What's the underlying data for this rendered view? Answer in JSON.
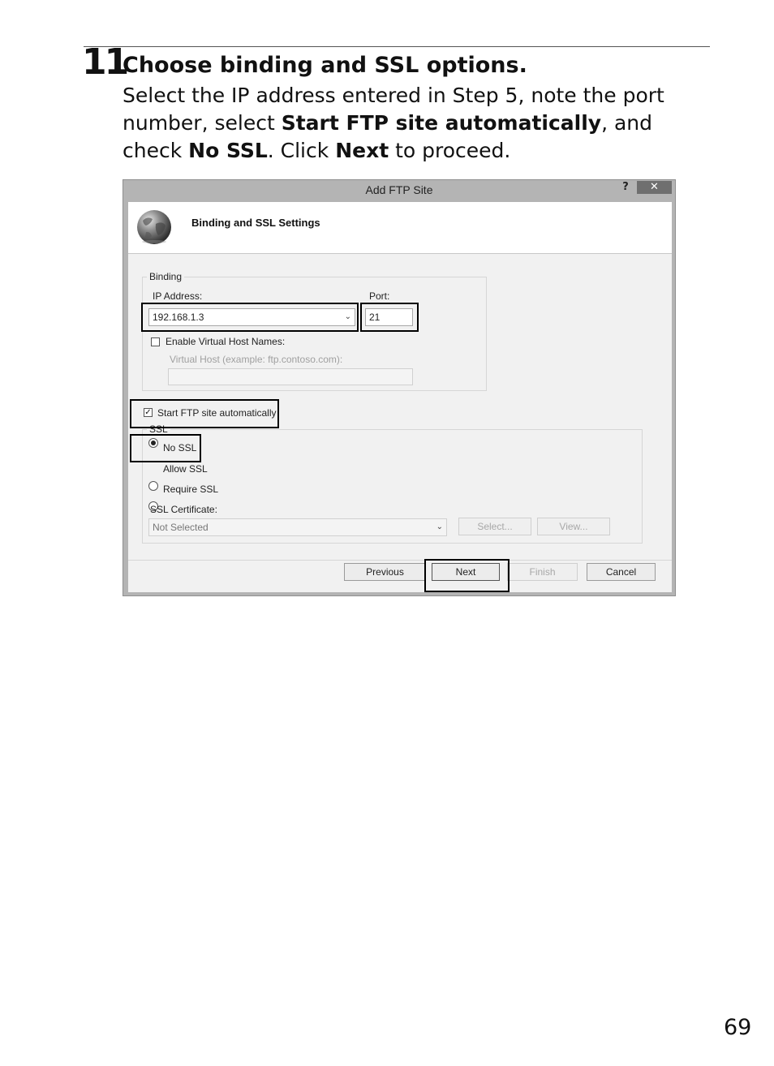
{
  "step": {
    "number": "11",
    "title": "Choose binding and SSL options.",
    "body": {
      "t1": "Select the IP address entered in Step 5, note the port number, select ",
      "b1": "Start FTP site automatically",
      "t2": ", and check ",
      "b2": "No SSL",
      "t3": ". Click ",
      "b3": "Next",
      "t4": " to proceed."
    }
  },
  "dialog": {
    "title": "Add FTP Site",
    "help": "?",
    "close": "✕",
    "header_title": "Binding and SSL Settings",
    "binding": {
      "legend": "Binding",
      "ip_label": "IP Address:",
      "ip_value": "192.168.1.3",
      "port_label": "Port:",
      "port_value": "21",
      "virtual_host_checkbox": "Enable Virtual Host Names:",
      "virtual_host_label": "Virtual Host (example: ftp.contoso.com):",
      "virtual_host_value": ""
    },
    "start_automatically": "Start FTP site automatically",
    "ssl": {
      "legend": "SSL",
      "options": [
        "No SSL",
        "Allow SSL",
        "Require SSL"
      ],
      "selected": "No SSL",
      "certificate_label": "SSL Certificate:",
      "certificate_value": "Not Selected",
      "select_button": "Select...",
      "view_button": "View..."
    },
    "buttons": {
      "previous": "Previous",
      "next": "Next",
      "finish": "Finish",
      "cancel": "Cancel"
    }
  },
  "page_number": "69"
}
